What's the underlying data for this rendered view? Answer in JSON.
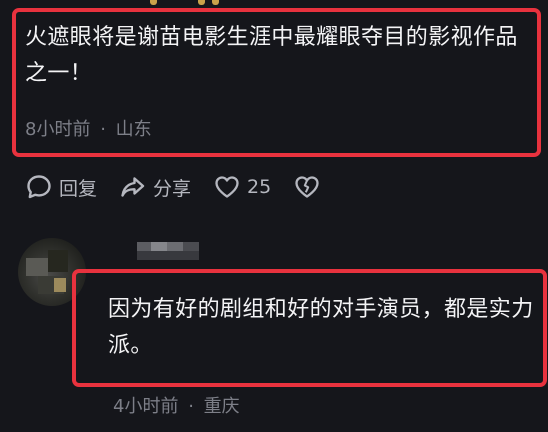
{
  "comment1": {
    "text": "火遮眼将是谢苗电影生涯中最耀眼夺目的影视作品之一！",
    "time": "8小时前",
    "location": "山东",
    "separator": "·"
  },
  "actions": {
    "reply_label": "回复",
    "share_label": "分享",
    "like_count": "25",
    "reply_icon": "chat-bubble-icon",
    "share_icon": "share-arrow-icon",
    "like_icon": "heart-icon",
    "dislike_icon": "broken-heart-icon"
  },
  "comment2": {
    "text": "因为有好的剧组和好的对手演员，都是实力派。",
    "time": "4小时前",
    "location": "重庆",
    "separator": "·"
  },
  "colors": {
    "background": "#15161b",
    "highlight_border": "#e8323e",
    "text": "#f4f4f6",
    "meta_text": "#7d7f88"
  }
}
